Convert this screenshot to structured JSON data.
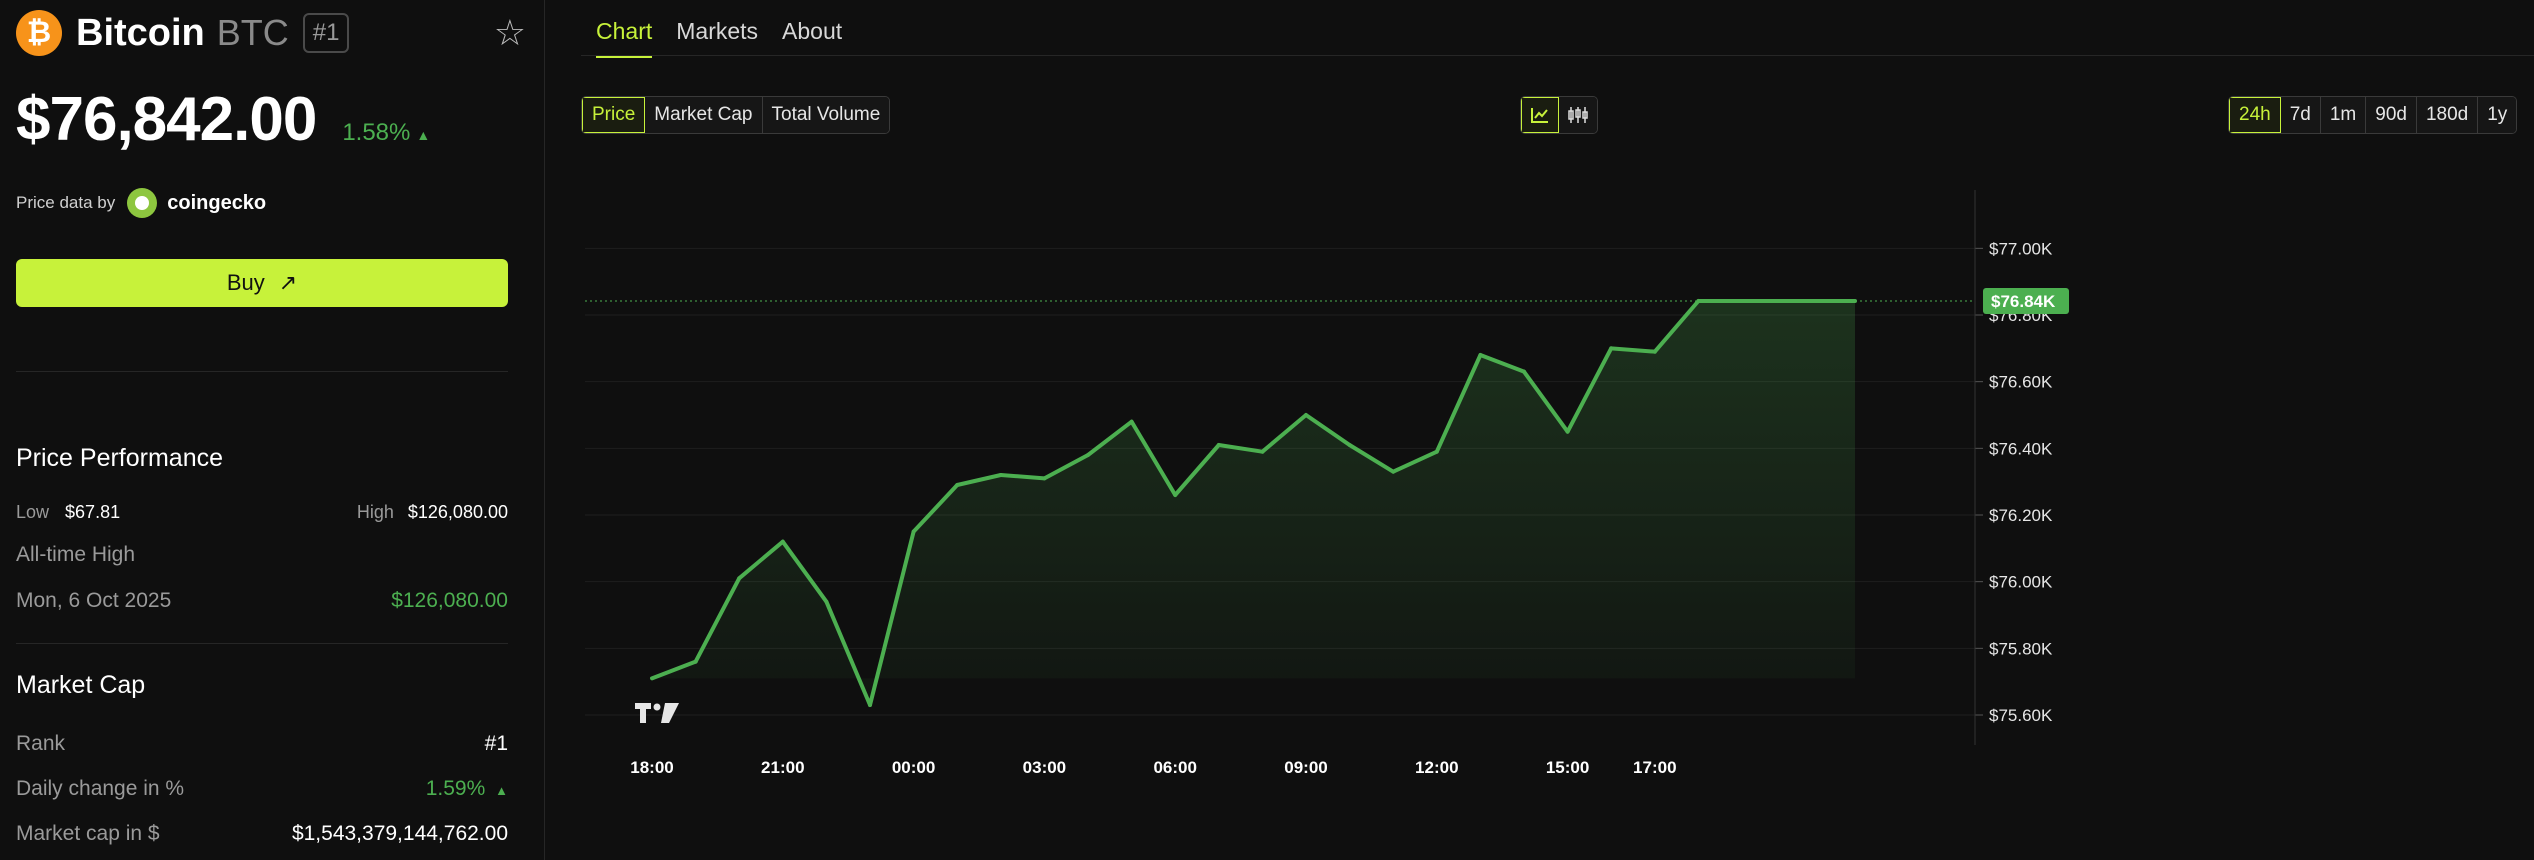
{
  "coin": {
    "logo_glyph": "₿",
    "name": "Bitcoin",
    "symbol": "BTC",
    "rank_badge": "#1",
    "price": "$76,842.00",
    "change": "1.58%",
    "change_arrow": "▲"
  },
  "price_source": {
    "label": "Price data by",
    "provider": "coingecko"
  },
  "buy": {
    "label": "Buy",
    "arrow": "↗"
  },
  "performance": {
    "title": "Price Performance",
    "low_label": "Low",
    "low_value": "$67.81",
    "high_label": "High",
    "high_value": "$126,080.00",
    "ath_label": "All-time High",
    "ath_date": "Mon, 6 Oct 2025",
    "ath_value": "$126,080.00"
  },
  "market_cap": {
    "title": "Market Cap",
    "rank_label": "Rank",
    "rank_value": "#1",
    "daily_change_label": "Daily change in %",
    "daily_change_value": "1.59%",
    "daily_change_arrow": "▲",
    "cap_label": "Market cap in $",
    "cap_value": "$1,543,379,144,762.00"
  },
  "tabs": [
    {
      "label": "Chart",
      "active": true
    },
    {
      "label": "Markets",
      "active": false
    },
    {
      "label": "About",
      "active": false
    }
  ],
  "metric_options": [
    {
      "label": "Price",
      "active": true
    },
    {
      "label": "Market Cap",
      "active": false
    },
    {
      "label": "Total Volume",
      "active": false
    }
  ],
  "chart_type_options": [
    {
      "icon": "line-chart-icon",
      "active": true
    },
    {
      "icon": "candlestick-icon",
      "active": false
    }
  ],
  "range_options": [
    {
      "label": "24h",
      "active": true
    },
    {
      "label": "7d",
      "active": false
    },
    {
      "label": "1m",
      "active": false
    },
    {
      "label": "90d",
      "active": false
    },
    {
      "label": "180d",
      "active": false
    },
    {
      "label": "1y",
      "active": false
    }
  ],
  "colors": {
    "accent": "#c7f23a",
    "up": "#4caf50",
    "down": "#e04848",
    "background": "#0f0f0f"
  },
  "chart_data": {
    "type": "line",
    "x_ticks": [
      "18:00",
      "21:00",
      "00:00",
      "03:00",
      "06:00",
      "09:00",
      "12:00",
      "15:00",
      "17:00"
    ],
    "y_ticks": [
      "$77.00K",
      "$76.80K",
      "$76.60K",
      "$76.40K",
      "$76.20K",
      "$76.00K",
      "$75.80K",
      "$75.60K"
    ],
    "y_tick_values": [
      77000,
      76800,
      76600,
      76400,
      76200,
      76000,
      75800,
      75600
    ],
    "ylim": [
      75510,
      77190
    ],
    "x_hours": [
      0,
      1,
      2,
      3,
      4,
      5,
      6,
      7,
      8,
      9,
      10,
      11,
      12,
      13,
      14,
      15,
      16,
      17,
      18,
      19,
      20,
      21,
      22,
      23,
      24,
      25
    ],
    "values": [
      75710,
      75760,
      76010,
      76120,
      75940,
      75630,
      76150,
      76290,
      76320,
      76310,
      76380,
      76480,
      76260,
      76410,
      76390,
      76500,
      76410,
      76330,
      76390,
      76680,
      76630,
      76450,
      76700,
      76690,
      76842,
      76842
    ],
    "x_tick_hours": [
      0,
      3,
      6,
      9,
      12,
      15,
      18,
      21,
      23
    ],
    "current_value": 76842,
    "current_label": "$76.84K",
    "grid": true,
    "watermark": "TV"
  }
}
